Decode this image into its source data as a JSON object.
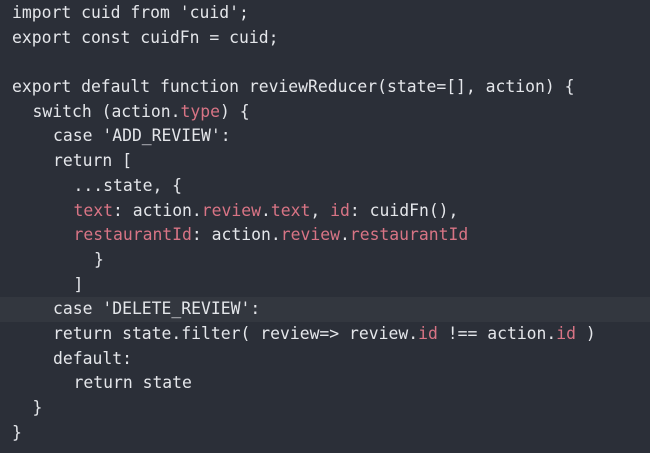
{
  "theme": {
    "background": "#2b2f38",
    "text": "#e4e6ea",
    "property": "#d87485",
    "current_line": "#33373f"
  },
  "highlighted_line": 13,
  "code_lines": [
    {
      "indent": 0,
      "tokens": [
        {
          "t": "import cuid from 'cuid';",
          "c": "plain"
        }
      ]
    },
    {
      "indent": 0,
      "tokens": [
        {
          "t": "export const cuidFn = cuid;",
          "c": "plain"
        }
      ]
    },
    {
      "indent": 0,
      "tokens": []
    },
    {
      "indent": 0,
      "tokens": [
        {
          "t": "export default function reviewReducer(state=[], action) {",
          "c": "plain"
        }
      ]
    },
    {
      "indent": 1,
      "tokens": [
        {
          "t": "switch (action.",
          "c": "plain"
        },
        {
          "t": "type",
          "c": "prop"
        },
        {
          "t": ") {",
          "c": "plain"
        }
      ]
    },
    {
      "indent": 2,
      "tokens": [
        {
          "t": "case 'ADD_REVIEW':",
          "c": "plain"
        }
      ]
    },
    {
      "indent": 2,
      "tokens": [
        {
          "t": "return [",
          "c": "plain"
        }
      ]
    },
    {
      "indent": 3,
      "tokens": [
        {
          "t": "...state, {",
          "c": "plain"
        }
      ]
    },
    {
      "indent": 3,
      "tokens": [
        {
          "t": "text",
          "c": "prop"
        },
        {
          "t": ": action.",
          "c": "plain"
        },
        {
          "t": "review",
          "c": "prop"
        },
        {
          "t": ".",
          "c": "plain"
        },
        {
          "t": "text",
          "c": "prop"
        },
        {
          "t": ", ",
          "c": "plain"
        },
        {
          "t": "id",
          "c": "prop"
        },
        {
          "t": ": cuidFn(),",
          "c": "plain"
        }
      ]
    },
    {
      "indent": 3,
      "tokens": [
        {
          "t": "restaurantId",
          "c": "prop"
        },
        {
          "t": ": action.",
          "c": "plain"
        },
        {
          "t": "review",
          "c": "prop"
        },
        {
          "t": ".",
          "c": "plain"
        },
        {
          "t": "restaurantId",
          "c": "prop"
        }
      ]
    },
    {
      "indent": 4,
      "tokens": [
        {
          "t": "}",
          "c": "plain"
        }
      ]
    },
    {
      "indent": 3,
      "tokens": [
        {
          "t": "]",
          "c": "plain"
        }
      ]
    },
    {
      "indent": 2,
      "tokens": [
        {
          "t": "case 'DELETE_REVIEW':",
          "c": "plain"
        }
      ]
    },
    {
      "indent": 2,
      "tokens": [
        {
          "t": "return state.filter( review=> review.",
          "c": "plain"
        },
        {
          "t": "id",
          "c": "prop"
        },
        {
          "t": " !== action.",
          "c": "plain"
        },
        {
          "t": "id",
          "c": "prop"
        },
        {
          "t": " )",
          "c": "plain"
        }
      ]
    },
    {
      "indent": 2,
      "tokens": [
        {
          "t": "default:",
          "c": "plain"
        }
      ]
    },
    {
      "indent": 3,
      "tokens": [
        {
          "t": "return state",
          "c": "plain"
        }
      ]
    },
    {
      "indent": 1,
      "tokens": [
        {
          "t": "}",
          "c": "plain"
        }
      ]
    },
    {
      "indent": 0,
      "tokens": [
        {
          "t": "}",
          "c": "plain"
        }
      ]
    }
  ]
}
